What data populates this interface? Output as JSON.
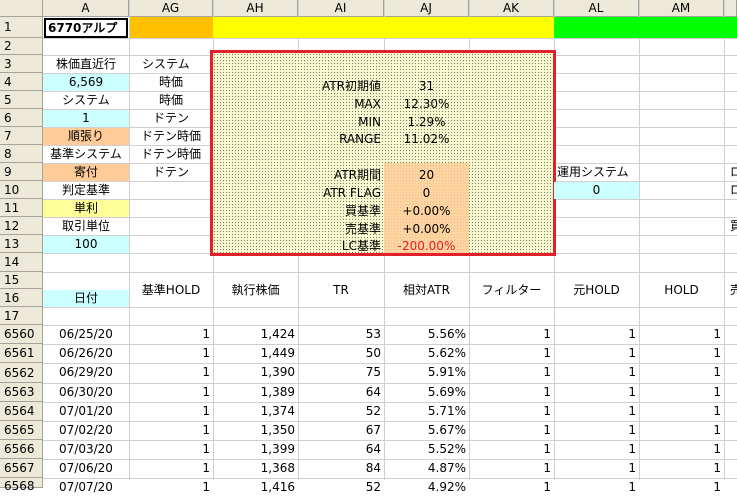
{
  "columns": [
    "A",
    "AG",
    "AH",
    "AI",
    "AJ",
    "AK",
    "AL",
    "AM"
  ],
  "row_numbers": [
    "1",
    "2",
    "3",
    "4",
    "5",
    "6",
    "7",
    "8",
    "9",
    "10",
    "11",
    "12",
    "13",
    "14",
    "15",
    "16",
    "17",
    "6560",
    "6561",
    "6562",
    "6563",
    "6564",
    "6565",
    "6566",
    "6567",
    "6568"
  ],
  "a_col": {
    "ticker": "6770アルプ",
    "r3": "株価直近行",
    "r4": "6,569",
    "r5": "システム",
    "r6": "1",
    "r7": "順張り",
    "r8": "基準システム",
    "r9": "寄付",
    "r10": "判定基準",
    "r11": "単利",
    "r12": "取引単位",
    "r13": "100",
    "r16": "日付"
  },
  "ag_col": {
    "r3": "システム",
    "r4": "時価",
    "r5": "時価",
    "r6": "ドテン",
    "r7": "ドテン時価",
    "r8": "ドテン時価",
    "r9": "ドテン"
  },
  "params": {
    "atr_init_label": "ATR初期値",
    "atr_init_value": "31",
    "max_label": "MAX",
    "max_value": "12.30%",
    "min_label": "MIN",
    "min_value": "1.29%",
    "range_label": "RANGE",
    "range_value": "11.02%",
    "atr_period_label": "ATR期間",
    "atr_period_value": "20",
    "atr_flag_label": "ATR FLAG",
    "atr_flag_value": "0",
    "buy_label": "買基準",
    "buy_value": "+0.00%",
    "sell_label": "売基準",
    "sell_value": "+0.00%",
    "lc_label": "LC基準",
    "lc_value": "-200.00%"
  },
  "right_side": {
    "al9": "運用システム",
    "al10": "0",
    "edge9": "ロ",
    "edge10": "ロ",
    "edge12": "買"
  },
  "table_headers": {
    "ag": "基準HOLD",
    "ah": "執行株価",
    "ai": "TR",
    "aj": "相対ATR",
    "ak": "フィルター",
    "al": "元HOLD",
    "am": "HOLD",
    "edge": "売"
  },
  "rows": [
    {
      "rn": "6560",
      "date": "06/25/20",
      "hold": "1",
      "price": "1,424",
      "tr": "53",
      "atr": "5.56%",
      "filter": "1",
      "orig": "1",
      "h": "1"
    },
    {
      "rn": "6561",
      "date": "06/26/20",
      "hold": "1",
      "price": "1,449",
      "tr": "50",
      "atr": "5.62%",
      "filter": "1",
      "orig": "1",
      "h": "1"
    },
    {
      "rn": "6562",
      "date": "06/29/20",
      "hold": "1",
      "price": "1,390",
      "tr": "75",
      "atr": "5.91%",
      "filter": "1",
      "orig": "1",
      "h": "1"
    },
    {
      "rn": "6563",
      "date": "06/30/20",
      "hold": "1",
      "price": "1,389",
      "tr": "64",
      "atr": "5.69%",
      "filter": "1",
      "orig": "1",
      "h": "1"
    },
    {
      "rn": "6564",
      "date": "07/01/20",
      "hold": "1",
      "price": "1,374",
      "tr": "52",
      "atr": "5.71%",
      "filter": "1",
      "orig": "1",
      "h": "1"
    },
    {
      "rn": "6565",
      "date": "07/02/20",
      "hold": "1",
      "price": "1,350",
      "tr": "67",
      "atr": "5.67%",
      "filter": "1",
      "orig": "1",
      "h": "1"
    },
    {
      "rn": "6566",
      "date": "07/03/20",
      "hold": "1",
      "price": "1,399",
      "tr": "64",
      "atr": "5.52%",
      "filter": "1",
      "orig": "1",
      "h": "1"
    },
    {
      "rn": "6567",
      "date": "07/06/20",
      "hold": "1",
      "price": "1,368",
      "tr": "84",
      "atr": "4.87%",
      "filter": "1",
      "orig": "1",
      "h": "1"
    },
    {
      "rn": "6568",
      "date": "07/07/20",
      "hold": "1",
      "price": "1,416",
      "tr": "52",
      "atr": "4.92%",
      "filter": "1",
      "orig": "1",
      "h": "1"
    }
  ],
  "colors": {
    "ag_row1": "#ffc000",
    "yellow_band": "#ffff00",
    "green_band": "#00ff00",
    "light_cyan": "#ccffff",
    "peach": "#ffcc99",
    "light_yellow": "#ffff99",
    "highlight_border": "#e0202a"
  }
}
